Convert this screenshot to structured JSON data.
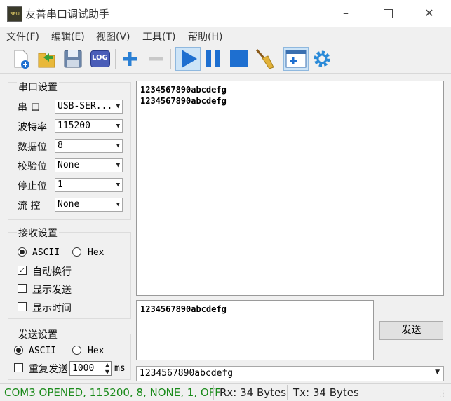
{
  "window": {
    "title": "友善串口调试助手",
    "icon_text": "SPU",
    "controls": [
      "minimize-icon",
      "maximize-icon",
      "close-icon"
    ]
  },
  "menu": [
    {
      "label": "文件(F)"
    },
    {
      "label": "编辑(E)"
    },
    {
      "label": "视图(V)"
    },
    {
      "label": "工具(T)"
    },
    {
      "label": "帮助(H)"
    }
  ],
  "toolbar": {
    "buttons": [
      "new-icon",
      "open-folder-icon",
      "save-icon",
      "log-icon",
      "plus-icon",
      "minus-icon",
      "play-icon",
      "pause-icon",
      "stop-icon",
      "broom-icon",
      "add-window-icon",
      "gear-icon"
    ],
    "log_label": "LOG"
  },
  "serial_settings": {
    "title": "串口设置",
    "rows": [
      {
        "label": "串  口",
        "value": "USB-SER..."
      },
      {
        "label": "波特率",
        "value": "115200"
      },
      {
        "label": "数据位",
        "value": "8"
      },
      {
        "label": "校验位",
        "value": "None"
      },
      {
        "label": "停止位",
        "value": "1"
      },
      {
        "label": "流  控",
        "value": "None"
      }
    ]
  },
  "receive_settings": {
    "title": "接收设置",
    "ascii_label": "ASCII",
    "hex_label": "Hex",
    "mode": "ASCII",
    "auto_wrap": {
      "label": "自动换行",
      "checked": true
    },
    "show_send": {
      "label": "显示发送",
      "checked": false
    },
    "show_time": {
      "label": "显示时间",
      "checked": false
    }
  },
  "send_settings": {
    "title": "发送设置",
    "ascii_label": "ASCII",
    "hex_label": "Hex",
    "mode": "ASCII",
    "repeat": {
      "label": "重复发送",
      "checked": false
    },
    "interval": "1000",
    "interval_unit": "ms"
  },
  "receive_text": [
    "1234567890abcdefg",
    "1234567890abcdefg"
  ],
  "send_text": "1234567890abcdefg",
  "send_button": "发送",
  "history_value": "1234567890abcdefg",
  "status": {
    "connection": "COM3 OPENED, 115200, 8, NONE, 1, OFF",
    "rx": "Rx: 34 Bytes",
    "tx": "Tx: 34 Bytes",
    "connection_color": "#1a8a1a"
  }
}
